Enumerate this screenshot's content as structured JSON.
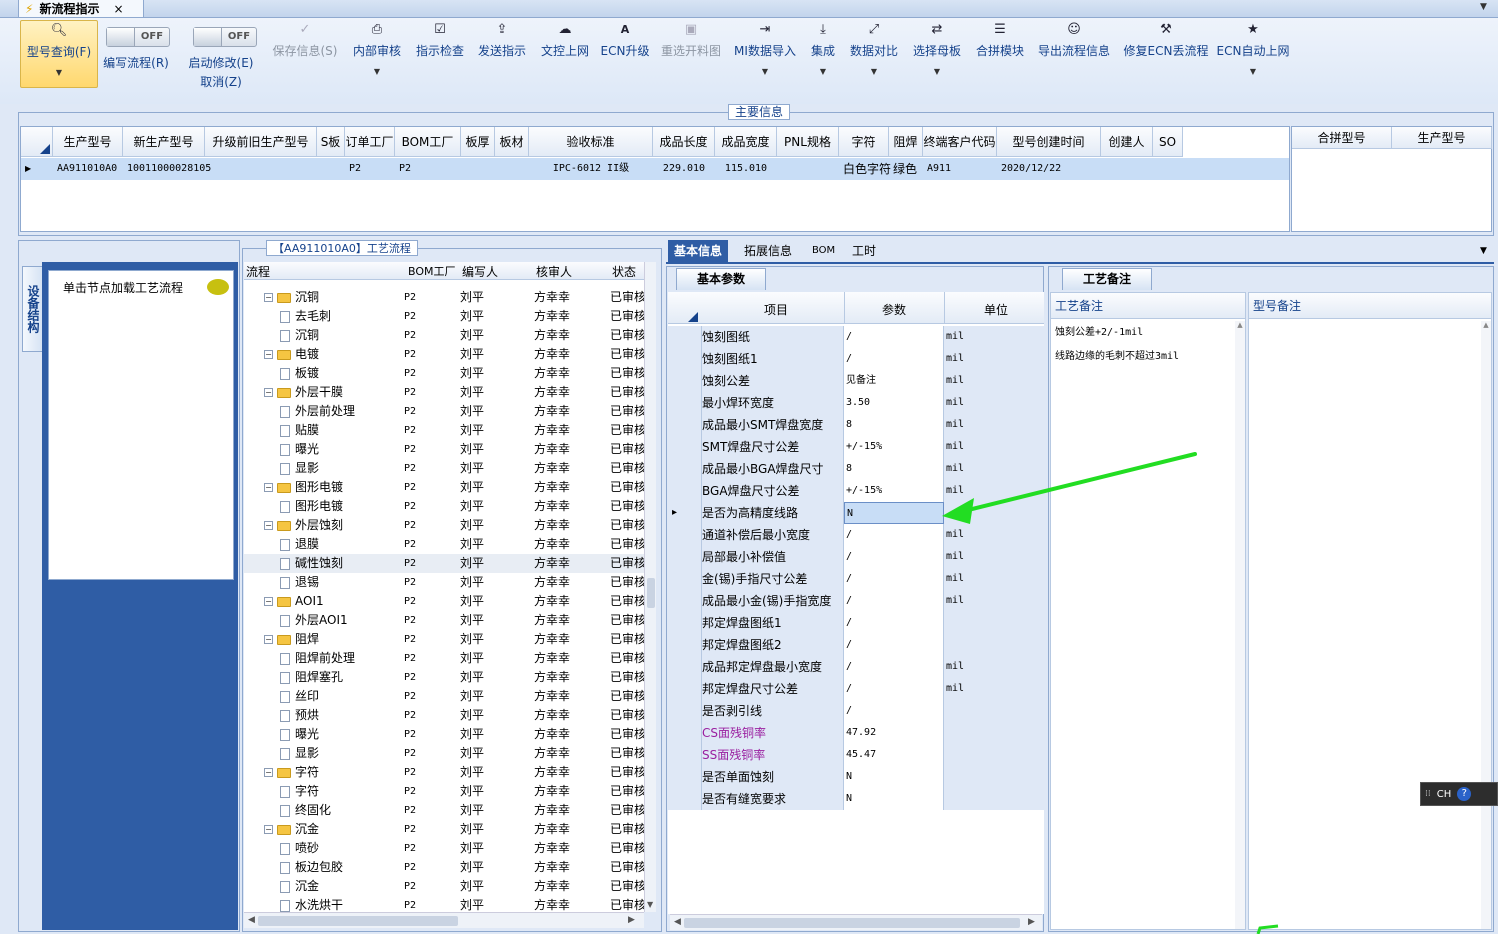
{
  "window": {
    "tab_title": "新流程指示"
  },
  "ribbon": {
    "buttons": [
      {
        "label": "型号查询(F)",
        "icon": "search-icon"
      },
      {
        "label": "编写流程(R)",
        "icon": "toggle"
      },
      {
        "label": "启动修改(E)",
        "icon": "toggle",
        "sub": "取消(Z)"
      },
      {
        "label": "保存信息(S)",
        "icon": "check-icon"
      },
      {
        "label": "内部审核",
        "icon": "printer-icon"
      },
      {
        "label": "指示检查",
        "icon": "checkbox-icon"
      },
      {
        "label": "发送指示",
        "icon": "upload-icon"
      },
      {
        "label": "文控上网",
        "icon": "cloud-upload-icon"
      },
      {
        "label": "ECN升级",
        "icon": "ecn-icon"
      },
      {
        "label": "重选开料图",
        "icon": "image-icon"
      },
      {
        "label": "MI数据导入",
        "icon": "import-icon"
      },
      {
        "label": "集成",
        "icon": "download-icon"
      },
      {
        "label": "数据对比",
        "icon": "compare-icon"
      },
      {
        "label": "选择母板",
        "icon": "shuffle-icon"
      },
      {
        "label": "合拼模块",
        "icon": "list-icon"
      },
      {
        "label": "导出流程信息",
        "icon": "smile-icon"
      },
      {
        "label": "修复ECN丢流程",
        "icon": "wrench-icon"
      },
      {
        "label": "ECN自动上网",
        "icon": "star-icon"
      }
    ],
    "toggle_off": "OFF"
  },
  "main_info": {
    "title": "主要信息",
    "columns": [
      "生产型号",
      "新生产型号",
      "升级前旧生产型号",
      "S板",
      "订单工厂",
      "BOM工厂",
      "板厚",
      "板材",
      "验收标准",
      "成品长度",
      "成品宽度",
      "PNL规格",
      "字符",
      "阻焊",
      "终端客户代码",
      "型号创建时间",
      "创建人",
      "SO"
    ],
    "row": [
      "AA911010A0",
      "10011000028105",
      "",
      "",
      "P2",
      "P2",
      "",
      "",
      "IPC-6012 II级",
      "229.010",
      "115.010",
      "",
      "白色字符",
      "绿色",
      "A911",
      "2020/12/22",
      "",
      ""
    ],
    "side_columns": [
      "合拼型号",
      "生产型号"
    ]
  },
  "side_nav": {
    "vertical_tab": "设备结构",
    "hint": "单击节点加载工艺流程"
  },
  "tree": {
    "title": "【AA911010A0】工艺流程",
    "columns": [
      "流程",
      "BOM工厂",
      "编写人",
      "核审人",
      "状态"
    ],
    "rows": [
      {
        "name": "沉铜",
        "level": 0,
        "folder": true
      },
      {
        "name": "去毛刺",
        "level": 1,
        "folder": false
      },
      {
        "name": "沉铜",
        "level": 1,
        "folder": false
      },
      {
        "name": "电镀",
        "level": 0,
        "folder": true
      },
      {
        "name": "板镀",
        "level": 1,
        "folder": false
      },
      {
        "name": "外层干膜",
        "level": 0,
        "folder": true
      },
      {
        "name": "外层前处理",
        "level": 1,
        "folder": false
      },
      {
        "name": "贴膜",
        "level": 1,
        "folder": false
      },
      {
        "name": "曝光",
        "level": 1,
        "folder": false
      },
      {
        "name": "显影",
        "level": 1,
        "folder": false
      },
      {
        "name": "图形电镀",
        "level": 0,
        "folder": true
      },
      {
        "name": "图形电镀",
        "level": 1,
        "folder": false
      },
      {
        "name": "外层蚀刻",
        "level": 0,
        "folder": true
      },
      {
        "name": "退膜",
        "level": 1,
        "folder": false
      },
      {
        "name": "碱性蚀刻",
        "level": 1,
        "folder": false,
        "selected": true
      },
      {
        "name": "退锡",
        "level": 1,
        "folder": false
      },
      {
        "name": "AOI1",
        "level": 0,
        "folder": true
      },
      {
        "name": "外层AOI1",
        "level": 1,
        "folder": false
      },
      {
        "name": "阻焊",
        "level": 0,
        "folder": true
      },
      {
        "name": "阻焊前处理",
        "level": 1,
        "folder": false
      },
      {
        "name": "阻焊塞孔",
        "level": 1,
        "folder": false
      },
      {
        "name": "丝印",
        "level": 1,
        "folder": false
      },
      {
        "name": "预烘",
        "level": 1,
        "folder": false
      },
      {
        "name": "曝光",
        "level": 1,
        "folder": false
      },
      {
        "name": "显影",
        "level": 1,
        "folder": false
      },
      {
        "name": "字符",
        "level": 0,
        "folder": true
      },
      {
        "name": "字符",
        "level": 1,
        "folder": false
      },
      {
        "name": "终固化",
        "level": 1,
        "folder": false
      },
      {
        "name": "沉金",
        "level": 0,
        "folder": true
      },
      {
        "name": "喷砂",
        "level": 1,
        "folder": false
      },
      {
        "name": "板边包胶",
        "level": 1,
        "folder": false
      },
      {
        "name": "沉金",
        "level": 1,
        "folder": false
      },
      {
        "name": "水洗烘干",
        "level": 1,
        "folder": false
      }
    ],
    "bom": "P2",
    "author": "刘平",
    "reviewer": "方幸幸",
    "status": "已审核"
  },
  "tabs": [
    "基本信息",
    "拓展信息",
    "BOM",
    "工时"
  ],
  "params": {
    "title": "基本参数",
    "columns": [
      "项目",
      "参数",
      "单位"
    ],
    "rows": [
      {
        "item": "蚀刻图纸",
        "value": "/",
        "unit": "mil"
      },
      {
        "item": "蚀刻图纸1",
        "value": "/",
        "unit": "mil"
      },
      {
        "item": "蚀刻公差",
        "value": "见备注",
        "unit": "mil"
      },
      {
        "item": "最小焊环宽度",
        "value": "3.50",
        "unit": "mil"
      },
      {
        "item": "成品最小SMT焊盘宽度",
        "value": "8",
        "unit": "mil"
      },
      {
        "item": "SMT焊盘尺寸公差",
        "value": "+/-15%",
        "unit": "mil"
      },
      {
        "item": "成品最小BGA焊盘尺寸",
        "value": "8",
        "unit": "mil"
      },
      {
        "item": "BGA焊盘尺寸公差",
        "value": "+/-15%",
        "unit": "mil"
      },
      {
        "item": "是否为高精度线路",
        "value": "N",
        "unit": "",
        "current": true
      },
      {
        "item": "通道补偿后最小宽度",
        "value": "/",
        "unit": "mil"
      },
      {
        "item": "局部最小补偿值",
        "value": "/",
        "unit": "mil"
      },
      {
        "item": "金(锡)手指尺寸公差",
        "value": "/",
        "unit": "mil"
      },
      {
        "item": "成品最小金(锡)手指宽度",
        "value": "/",
        "unit": "mil"
      },
      {
        "item": "邦定焊盘图纸1",
        "value": "/",
        "unit": ""
      },
      {
        "item": "邦定焊盘图纸2",
        "value": "/",
        "unit": ""
      },
      {
        "item": "成品邦定焊盘最小宽度",
        "value": "/",
        "unit": "mil"
      },
      {
        "item": "邦定焊盘尺寸公差",
        "value": "/",
        "unit": "mil"
      },
      {
        "item": "是否剥引线",
        "value": "/",
        "unit": ""
      },
      {
        "item": "CS面残铜率",
        "value": "47.92",
        "unit": "",
        "accent": true
      },
      {
        "item": "SS面残铜率",
        "value": "45.47",
        "unit": "",
        "accent": true
      },
      {
        "item": "是否单面蚀刻",
        "value": "N",
        "unit": ""
      },
      {
        "item": "是否有缝宽要求",
        "value": "N",
        "unit": ""
      }
    ]
  },
  "notes": {
    "title": "工艺备注",
    "col1": "工艺备注",
    "col2": "型号备注",
    "lines": [
      "蚀刻公差+2/-1mil",
      "线路边缘的毛刺不超过3mil"
    ]
  },
  "ime": {
    "text": "CH"
  },
  "colors": {
    "accent": "#15428b",
    "arrow": "#22dd22",
    "purple": "#9a1fa0",
    "highlight": "#c8ddf6"
  }
}
